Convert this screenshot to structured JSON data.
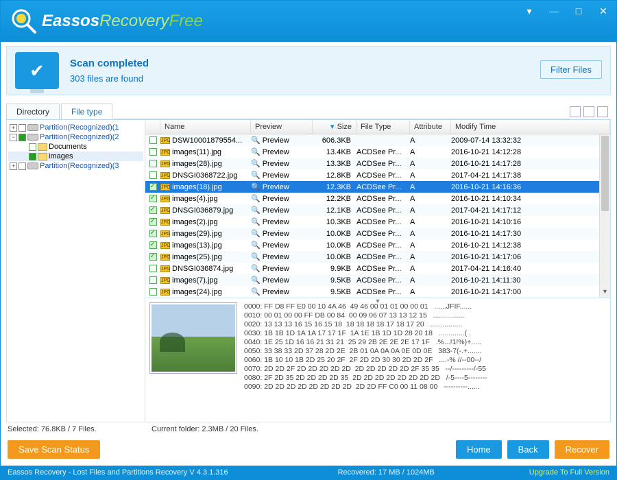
{
  "brand": {
    "part1": "Eassos",
    "part2": "Recovery",
    "part3": "Free"
  },
  "scan": {
    "title": "Scan completed",
    "subtitle": "303 files are found",
    "filter_btn": "Filter Files"
  },
  "tabs": {
    "directory": "Directory",
    "filetype": "File type"
  },
  "tree": {
    "p1": "Partition(Recognized)(1",
    "p2": "Partition(Recognized)(2",
    "docs": "Documents",
    "images": "images",
    "p3": "Partition(Recognized)(3"
  },
  "columns": {
    "name": "Name",
    "preview": "Preview",
    "size": "Size",
    "filetype": "File Type",
    "attribute": "Attribute",
    "modify": "Modify Time"
  },
  "preview_label": "Preview",
  "rows": [
    {
      "chk": false,
      "name": "DSW10001879554...",
      "size": "606.3KB",
      "type": "",
      "attr": "A",
      "mod": "2009-07-14 13:32:32"
    },
    {
      "chk": false,
      "name": "images(11).jpg",
      "size": "13.4KB",
      "type": "ACDSee Pr...",
      "attr": "A",
      "mod": "2016-10-21 14:12:28"
    },
    {
      "chk": false,
      "name": "images(28).jpg",
      "size": "13.3KB",
      "type": "ACDSee Pr...",
      "attr": "A",
      "mod": "2016-10-21 14:17:28"
    },
    {
      "chk": false,
      "name": "DNSGI0368722.jpg",
      "size": "12.8KB",
      "type": "ACDSee Pr...",
      "attr": "A",
      "mod": "2017-04-21 14:17:38"
    },
    {
      "chk": true,
      "sel": true,
      "name": "images(18).jpg",
      "size": "12.3KB",
      "type": "ACDSee Pr...",
      "attr": "A",
      "mod": "2016-10-21 14:16:36"
    },
    {
      "chk": true,
      "name": "images(4).jpg",
      "size": "12.2KB",
      "type": "ACDSee Pr...",
      "attr": "A",
      "mod": "2016-10-21 14:10:34"
    },
    {
      "chk": true,
      "name": "DNSGI036879.jpg",
      "size": "12.1KB",
      "type": "ACDSee Pr...",
      "attr": "A",
      "mod": "2017-04-21 14:17:12"
    },
    {
      "chk": true,
      "name": "images(2).jpg",
      "size": "10.3KB",
      "type": "ACDSee Pr...",
      "attr": "A",
      "mod": "2016-10-21 14:10:16"
    },
    {
      "chk": true,
      "name": "images(29).jpg",
      "size": "10.0KB",
      "type": "ACDSee Pr...",
      "attr": "A",
      "mod": "2016-10-21 14:17:30"
    },
    {
      "chk": true,
      "name": "images(13).jpg",
      "size": "10.0KB",
      "type": "ACDSee Pr...",
      "attr": "A",
      "mod": "2016-10-21 14:12:38"
    },
    {
      "chk": true,
      "name": "images(25).jpg",
      "size": "10.0KB",
      "type": "ACDSee Pr...",
      "attr": "A",
      "mod": "2016-10-21 14:17:06"
    },
    {
      "chk": false,
      "name": "DNSGI036874.jpg",
      "size": "9.9KB",
      "type": "ACDSee Pr...",
      "attr": "A",
      "mod": "2017-04-21 14:16:40"
    },
    {
      "chk": false,
      "name": "images(7).jpg",
      "size": "9.5KB",
      "type": "ACDSee Pr...",
      "attr": "A",
      "mod": "2016-10-21 14:11:30"
    },
    {
      "chk": false,
      "name": "images(24).jpg",
      "size": "9.5KB",
      "type": "ACDSee Pr...",
      "attr": "A",
      "mod": "2016-10-21 14:17:00"
    }
  ],
  "hex": "0000: FF D8 FF E0 00 10 4A 46  49 46 00 01 01 00 00 01   ......JFIF......\n0010: 00 01 00 00 FF DB 00 84  00 09 06 07 13 13 12 15   ................\n0020: 13 13 13 16 15 16 15 18  18 18 18 18 17 18 17 20   ................\n0030: 1B 1B 1D 1A 1A 17 17 1F  1A 1E 1B 1D 1D 28 20 18   .............( .\n0040: 1E 25 1D 16 16 21 31 21  25 29 2B 2E 2E 2E 17 1F   .%...!1!%)+.....\n0050: 33 38 33 2D 37 28 2D 2E  2B 01 0A 0A 0A 0E 0D 0E   383-7(-.+.......\n0060: 1B 10 10 1B 2D 25 20 2F  2F 2D 2D 30 30 2D 2D 2F   ....-% //--00--/\n0070: 2D 2D 2F 2D 2D 2D 2D 2D  2D 2D 2D 2D 2D 2F 35 35   --/---------/-55\n0080: 2F 2D 35 2D 2D 2D 2D 35  2D 2D 2D 2D 2D 2D 2D 2D   /-5----5--------\n0090: 2D 2D 2D 2D 2D 2D 2D 2D  2D 2D FF C0 00 11 08 00   ----------......",
  "status": {
    "selected": "Selected: 76.8KB / 7 Files.",
    "current": "Current folder: 2.3MB / 20 Files."
  },
  "buttons": {
    "save": "Save Scan Status",
    "home": "Home",
    "back": "Back",
    "recover": "Recover"
  },
  "footer": {
    "left": "Eassos Recovery - Lost Files and Partitions Recovery  V 4.3.1.316",
    "recovered": "Recovered: 17 MB / 1024MB",
    "upgrade": "Upgrade To Full Version"
  }
}
